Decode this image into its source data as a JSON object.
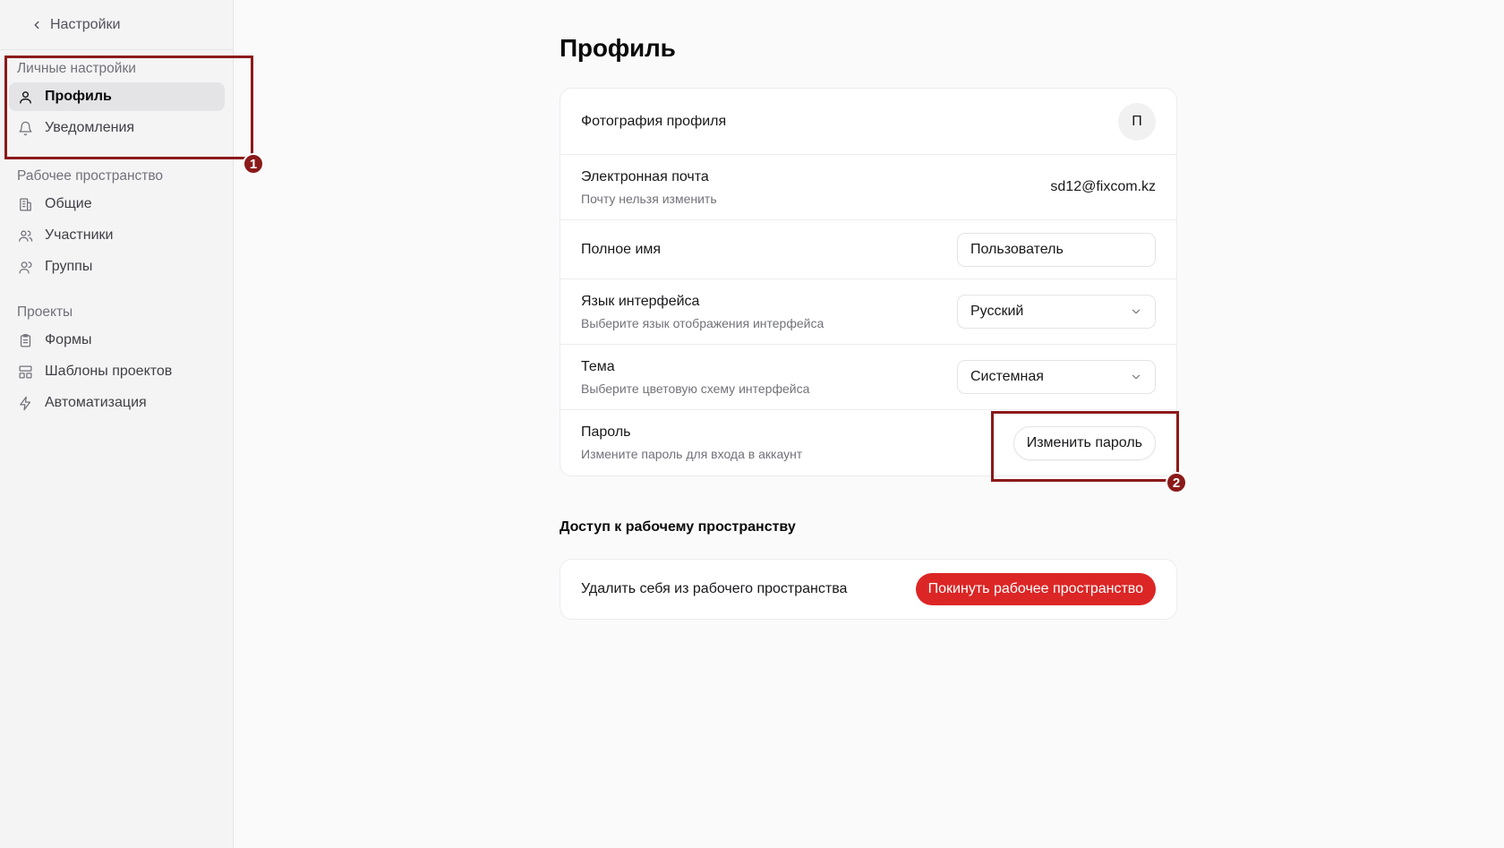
{
  "sidebar": {
    "back_label": "Настройки",
    "sections": [
      {
        "label": "Личные настройки",
        "items": [
          {
            "label": "Профиль",
            "icon": "user-icon",
            "active": true
          },
          {
            "label": "Уведомления",
            "icon": "bell-icon",
            "active": false
          }
        ]
      },
      {
        "label": "Рабочее пространство",
        "items": [
          {
            "label": "Общие",
            "icon": "building-icon",
            "active": false
          },
          {
            "label": "Участники",
            "icon": "users-icon",
            "active": false
          },
          {
            "label": "Группы",
            "icon": "group-icon",
            "active": false
          }
        ]
      },
      {
        "label": "Проекты",
        "items": [
          {
            "label": "Формы",
            "icon": "clipboard-icon",
            "active": false
          },
          {
            "label": "Шаблоны проектов",
            "icon": "layout-icon",
            "active": false
          },
          {
            "label": "Автоматизация",
            "icon": "zap-icon",
            "active": false
          }
        ]
      }
    ]
  },
  "main": {
    "title": "Профиль",
    "profile": {
      "photo_label": "Фотография профиля",
      "avatar_letter": "П",
      "email_label": "Электронная почта",
      "email_hint": "Почту нельзя изменить",
      "email_value": "sd12@fixcom.kz",
      "fullname_label": "Полное имя",
      "fullname_value": "Пользователь",
      "language_label": "Язык интерфейса",
      "language_hint": "Выберите язык отображения интерфейса",
      "language_value": "Русский",
      "theme_label": "Тема",
      "theme_hint": "Выберите цветовую схему интерфейса",
      "theme_value": "Системная",
      "password_label": "Пароль",
      "password_hint": "Измените пароль для входа в аккаунт",
      "password_button": "Изменить пароль"
    },
    "workspace_access": {
      "title": "Доступ к рабочему пространству",
      "leave_label": "Удалить себя из рабочего пространства",
      "leave_button": "Покинуть рабочее пространство"
    }
  },
  "annotations": [
    {
      "number": "1"
    },
    {
      "number": "2"
    }
  ],
  "colors": {
    "danger": "#dc2626",
    "annotation": "#8b1a1a",
    "sidebar_bg": "#f4f4f5",
    "active_item_bg": "#e4e4e7"
  }
}
